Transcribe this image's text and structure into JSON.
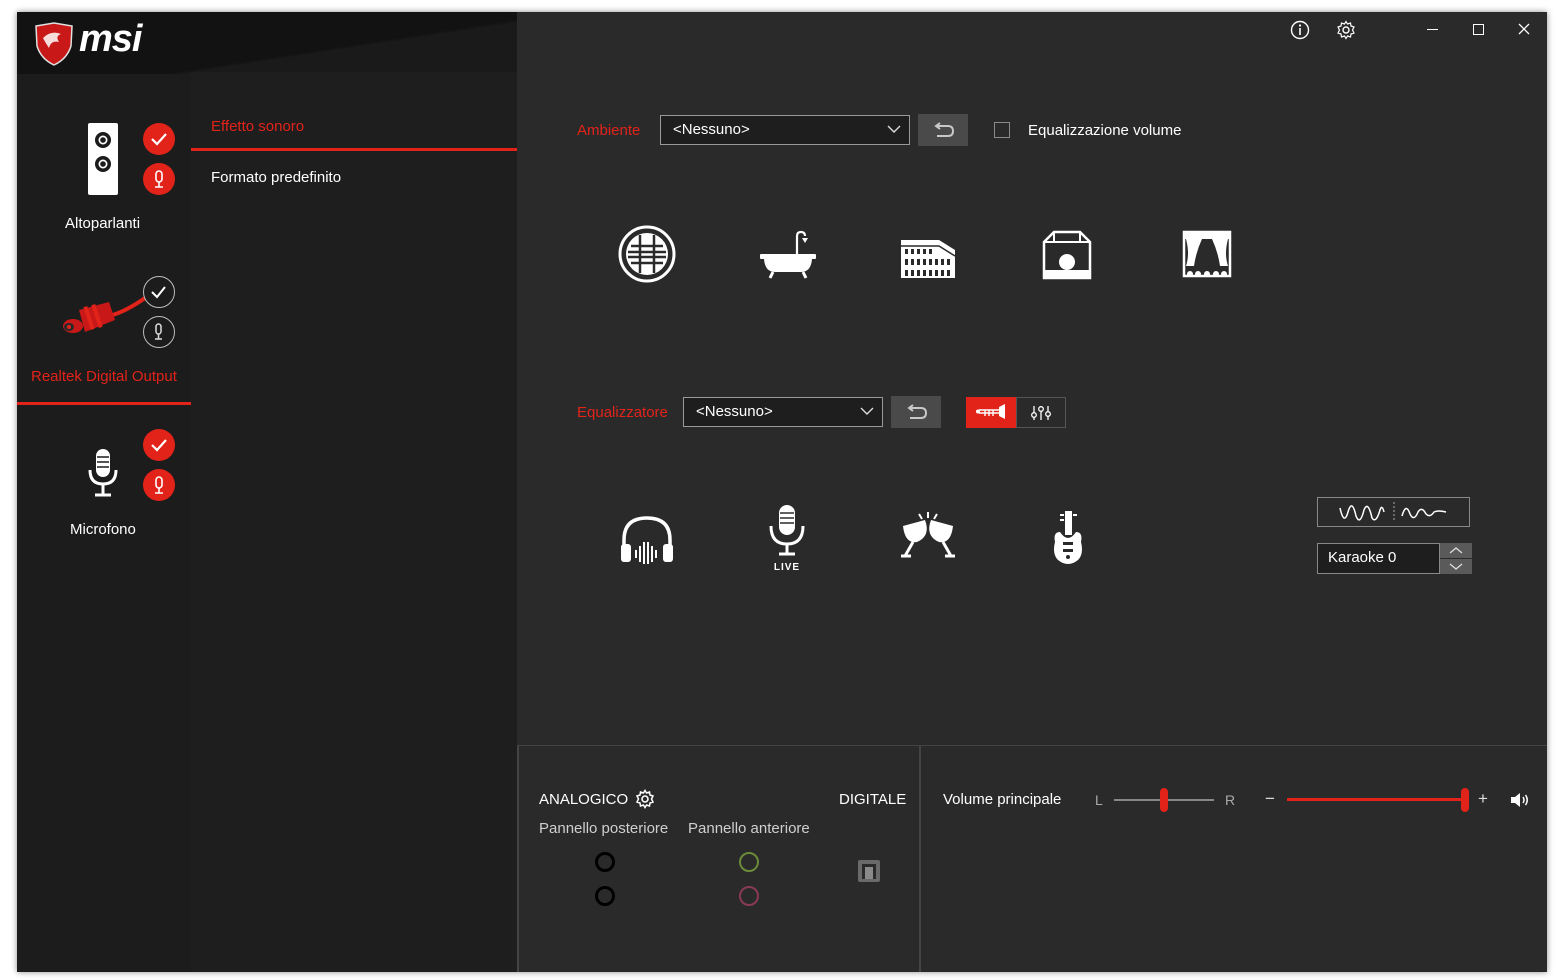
{
  "app": {
    "logo_text": "msi"
  },
  "window_controls": {
    "info": "info-icon",
    "settings": "gear-icon",
    "minimize": "minimize-icon",
    "maximize": "maximize-icon",
    "close": "close-icon"
  },
  "devices": [
    {
      "label": "Altoparlanti",
      "active": false
    },
    {
      "label": "Realtek Digital Output",
      "active": true
    },
    {
      "label": "Microfono",
      "active": false
    }
  ],
  "subnav": {
    "items": [
      {
        "label": "Effetto sonoro",
        "active": true
      },
      {
        "label": "Formato predefinito",
        "active": false
      }
    ]
  },
  "ambiente": {
    "label": "Ambiente",
    "value": "<Nessuno>",
    "checkbox_label": "Equalizzazione volume",
    "checked": false,
    "icons": [
      "sphere-icon",
      "bathtub-icon",
      "colosseum-icon",
      "room-icon",
      "theater-icon"
    ]
  },
  "equalizzatore": {
    "label": "Equalizzatore",
    "value": "<Nessuno>",
    "icons": [
      "headphones-icon",
      "live-microphone-icon",
      "toast-glasses-icon",
      "guitar-icon"
    ],
    "live_text": "LIVE"
  },
  "karaoke": {
    "value": "Karaoke 0"
  },
  "connectors": {
    "analog_label": "ANALOGICO",
    "digital_label": "DIGITALE",
    "rear_label": "Pannello posteriore",
    "front_label": "Pannello anteriore"
  },
  "volume": {
    "label": "Volume principale",
    "balance_left": "L",
    "balance_right": "R",
    "minus": "−",
    "plus": "+",
    "balance": 0.5,
    "level": 1.0
  },
  "colors": {
    "accent": "#e2231a",
    "bg": "#2a2a2a",
    "sidebar": "#1c1c1c"
  }
}
